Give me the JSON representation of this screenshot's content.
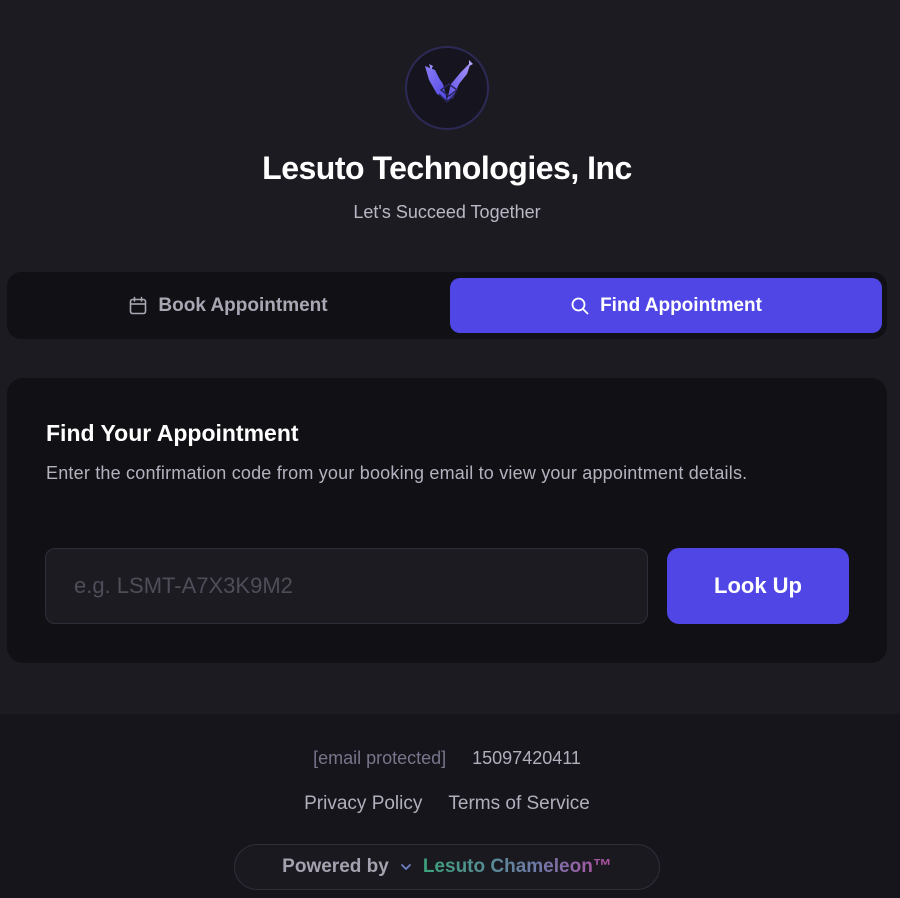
{
  "brand": {
    "name": "Lesuto Technologies, Inc",
    "tagline": "Let's Succeed Together",
    "logo_icon": "winged-check-logo-icon"
  },
  "tabs": [
    {
      "label": "Book Appointment",
      "icon": "calendar-icon",
      "active": false
    },
    {
      "label": "Find Appointment",
      "icon": "search-icon",
      "active": true
    }
  ],
  "find_card": {
    "title": "Find Your Appointment",
    "description": "Enter the confirmation code from your booking email to view your appointment details.",
    "code_input": {
      "placeholder": "e.g. LSMT-A7X3K9M2",
      "value": ""
    },
    "lookup_label": "Look Up"
  },
  "footer": {
    "email": "[email protected]",
    "phone": "15097420411",
    "links": [
      "Privacy Policy",
      "Terms of Service"
    ],
    "powered_by_label": "Powered by",
    "powered_by_icon": "chevron-down-icon",
    "powered_by_name": "Lesuto Chameleon™"
  },
  "colors": {
    "accent": "#4f46e5",
    "background": "#1c1b22",
    "surface": "#111015",
    "footer": "#16151c"
  }
}
